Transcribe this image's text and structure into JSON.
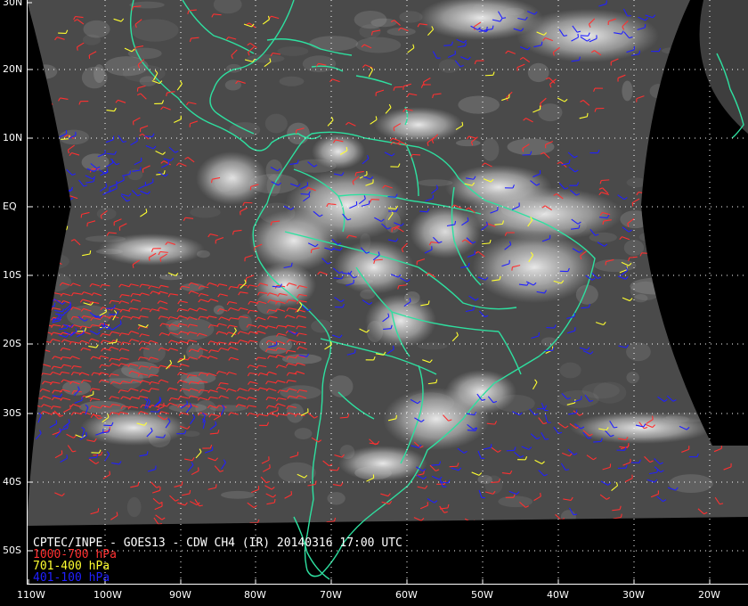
{
  "map": {
    "background_color": "#000000",
    "land_border_color": "#2ee0a0",
    "grid_color": "#ffffff"
  },
  "lat_labels": [
    "30N",
    "20N",
    "10N",
    "EQ",
    "10S",
    "20S",
    "30S",
    "40S",
    "50S"
  ],
  "lon_labels": [
    "110W",
    "100W",
    "90W",
    "80W",
    "70W",
    "60W",
    "50W",
    "40W",
    "30W",
    "20W"
  ],
  "caption": {
    "title": "CPTEC/INPE - GOES13 - CDW CH4 (IR) 20140316 17:00 UTC",
    "layers": [
      {
        "label": "1000-700 hPa",
        "color": "#ff3030",
        "icon": "red-wind-barb"
      },
      {
        "label": "701-400 hPa",
        "color": "#ffff30",
        "icon": "yellow-wind-barb"
      },
      {
        "label": "401-100 hPa",
        "color": "#2020ff",
        "icon": "blue-wind-barb"
      }
    ]
  }
}
